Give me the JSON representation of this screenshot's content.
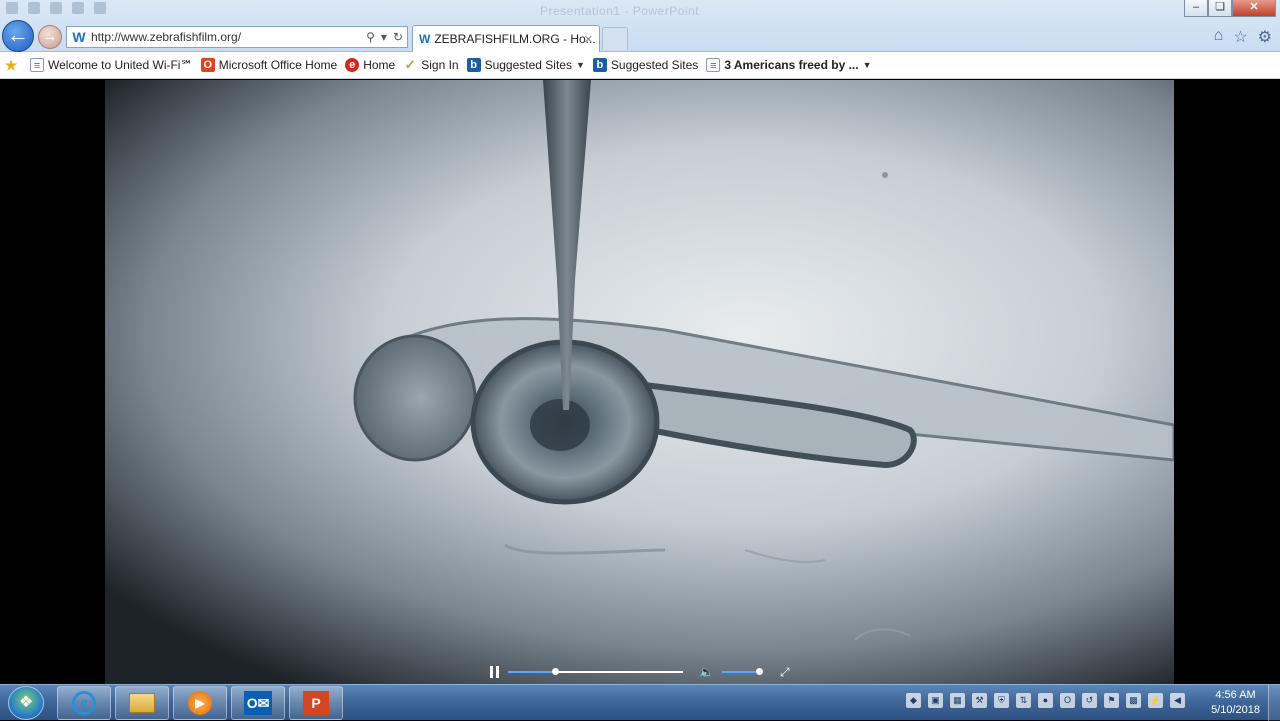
{
  "browser": {
    "address": {
      "url": "http://www.zebrafishfilm.org/"
    },
    "tab": {
      "title": "ZEBRAFISHFILM.ORG - Ho...",
      "logo_letter": "W"
    },
    "window_title_faded": "Presentation1 - PowerPoint"
  },
  "favorites": [
    {
      "label": "Welcome to United Wi-Fi℠",
      "icon": "page-icon",
      "bold": false,
      "dropdown": false
    },
    {
      "label": "Microsoft Office Home",
      "icon": "office-icon",
      "bold": false,
      "dropdown": false
    },
    {
      "label": "Home",
      "icon": "e-icon",
      "bold": false,
      "dropdown": false
    },
    {
      "label": "Sign In",
      "icon": "sign-in-icon",
      "bold": false,
      "dropdown": false
    },
    {
      "label": "Suggested Sites",
      "icon": "bing-icon",
      "bold": false,
      "dropdown": true
    },
    {
      "label": "Suggested Sites",
      "icon": "bing-icon",
      "bold": false,
      "dropdown": false
    },
    {
      "label": "3 Americans freed by ...",
      "icon": "page-icon",
      "bold": true,
      "dropdown": true
    }
  ],
  "video": {
    "playback_progress": 0.27,
    "volume": 1.0,
    "state": "playing"
  },
  "taskbar": {
    "apps": [
      "internet-explorer",
      "file-explorer",
      "media-player",
      "outlook",
      "powerpoint"
    ],
    "clock": {
      "time": "4:56 AM",
      "date": "5/10/2018"
    }
  }
}
